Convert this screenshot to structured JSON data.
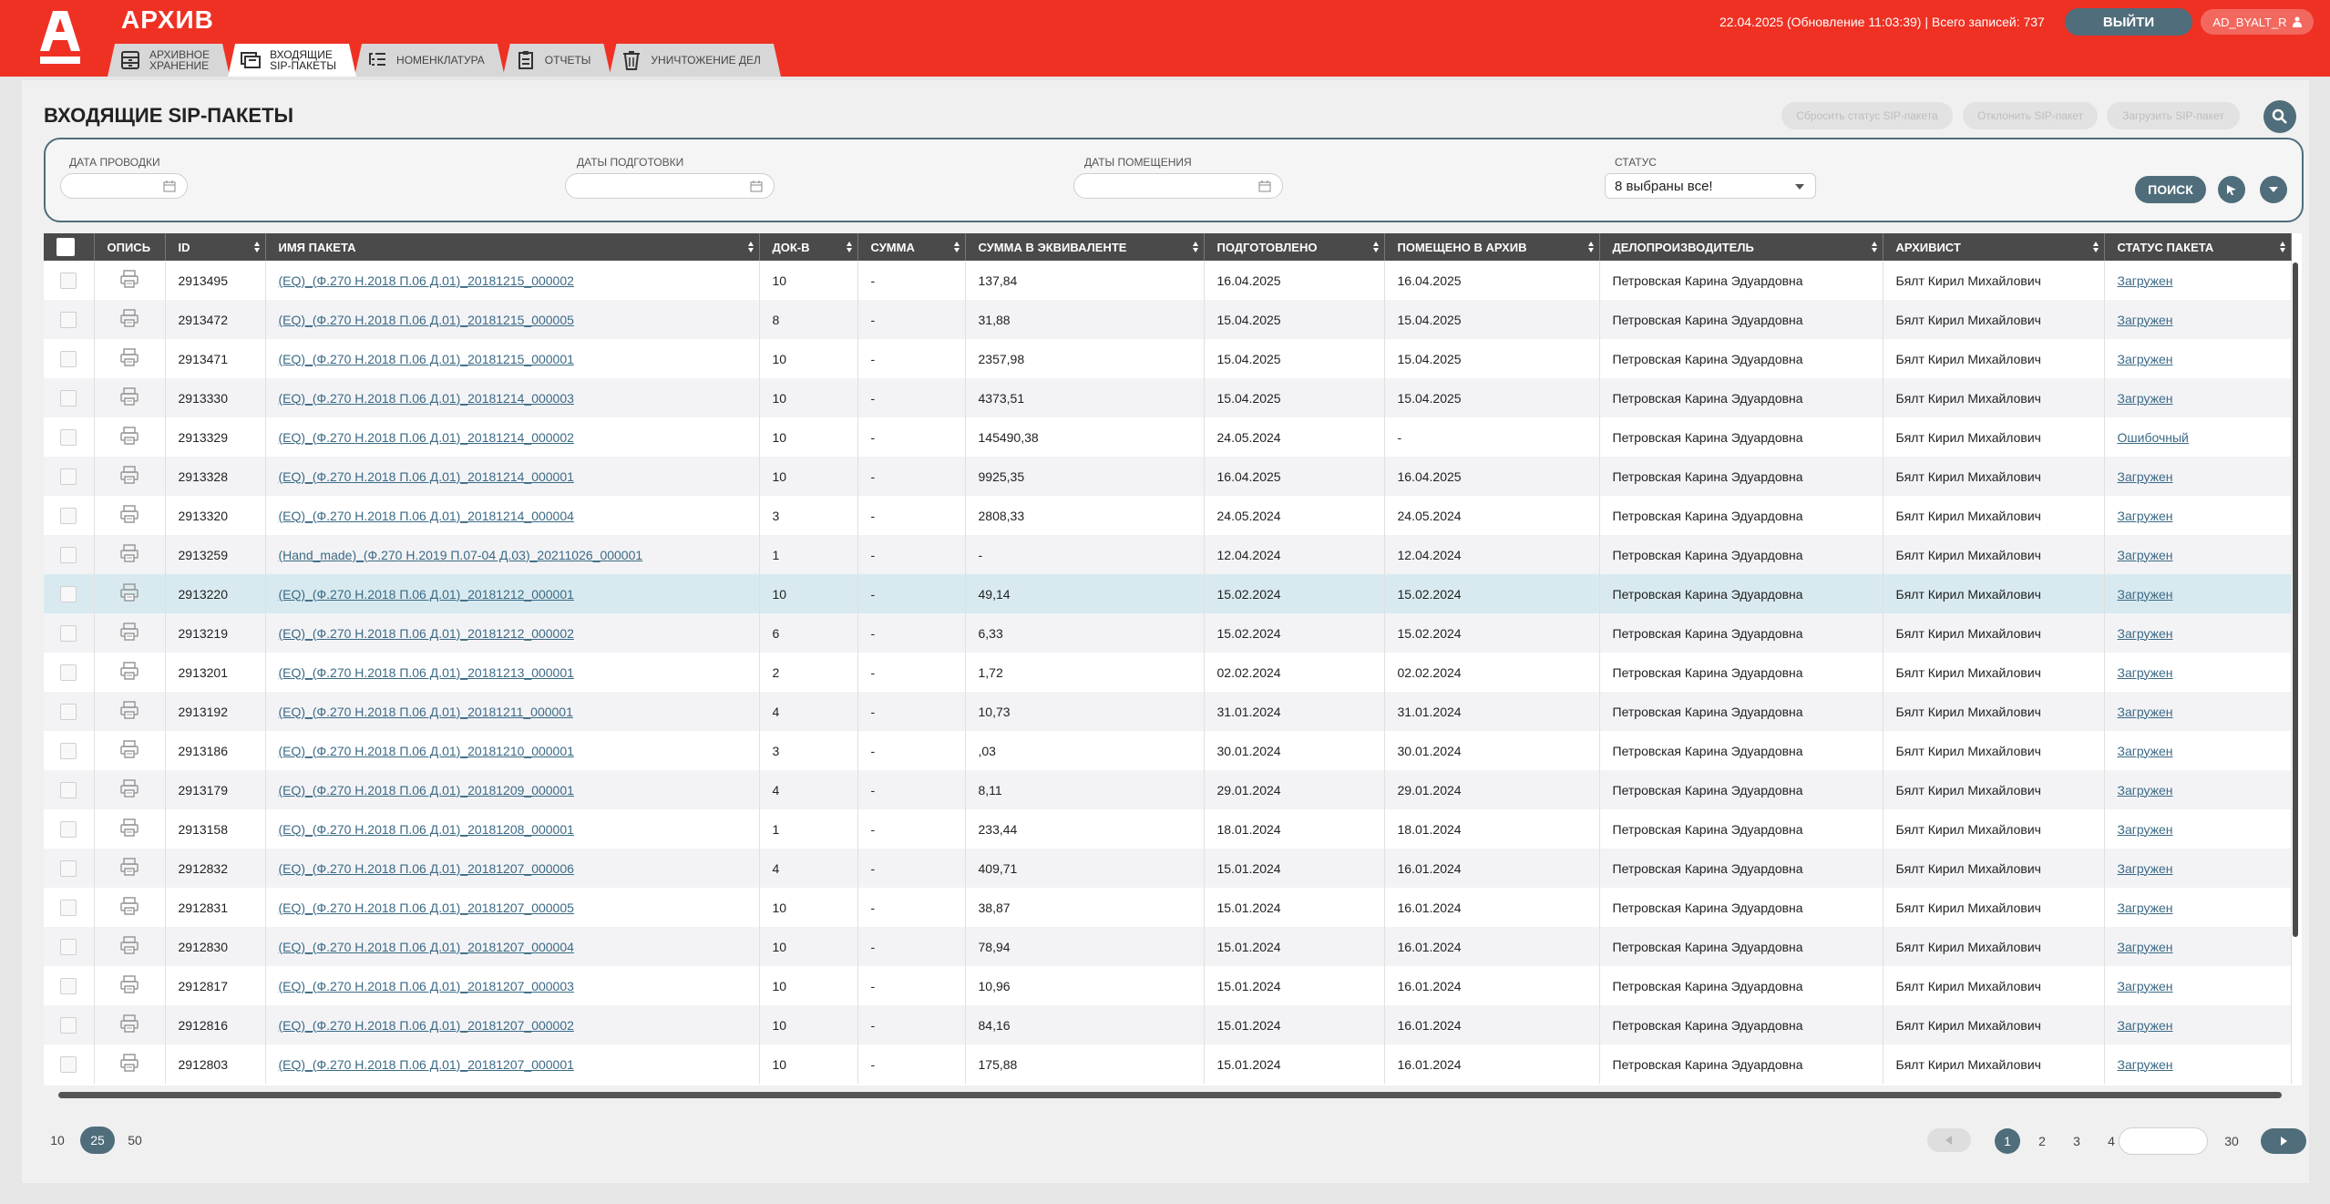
{
  "header": {
    "title": "АРХИВ",
    "info": "22.04.2025 (Обновление 11:03:39) | Всего записей: 737",
    "logout_label": "ВЫЙТИ",
    "user_label": "AD_BYALT_R",
    "tabs": [
      {
        "label": "АРХИВНОЕ\nХРАНЕНИЕ",
        "icon": "archive-storage-icon"
      },
      {
        "label": "ВХОДЯЩИЕ\nSIP-ПАКЕТЫ",
        "icon": "incoming-packages-icon"
      },
      {
        "label": "НОМЕНКЛАТУРА",
        "icon": "nomenclature-icon"
      },
      {
        "label": "ОТЧЕТЫ",
        "icon": "reports-icon"
      },
      {
        "label": "УНИЧТОЖЕНИЕ ДЕЛ",
        "icon": "trash-icon"
      }
    ]
  },
  "page": {
    "title": "ВХОДЯЩИЕ SIP-ПАКЕТЫ",
    "actions": {
      "reset_status": "Сбросить статус SIP-пакета",
      "reject": "Отклонить SIP-пакет",
      "upload": "Загрузить SIP-пакет"
    }
  },
  "filters": {
    "date_posting_label": "ДАТА ПРОВОДКИ",
    "date_preparation_label": "ДАТЫ ПОДГОТОВКИ",
    "date_placement_label": "ДАТЫ ПОМЕЩЕНИЯ",
    "status_label": "СТАТУС",
    "status_value": "8 выбраны все!",
    "search_label": "ПОИСК"
  },
  "table": {
    "columns": [
      "ОПИСЬ",
      "ID",
      "ИМЯ ПАКЕТА",
      "ДОК-В",
      "СУММА",
      "СУММА В ЭКВИВАЛЕНТЕ",
      "ПОДГОТОВЛЕНО",
      "ПОМЕЩЕНО В АРХИВ",
      "ДЕЛОПРОИЗВОДИТЕЛЬ",
      "АРХИВИСТ",
      "СТАТУС ПАКЕТА"
    ],
    "rows": [
      {
        "id": "2913495",
        "name": "(EQ)_(Ф.270 Н.2018 П.06 Д.01)_20181215_000002",
        "docs": "10",
        "sum": "-",
        "equiv": "137,84",
        "prepared": "16.04.2025",
        "archived": "16.04.2025",
        "clerk": "Петровская Карина Эдуардовна",
        "archivist": "Бялт Кирил Михайлович",
        "status": "Загружен"
      },
      {
        "id": "2913472",
        "name": "(EQ)_(Ф.270 Н.2018 П.06 Д.01)_20181215_000005",
        "docs": "8",
        "sum": "-",
        "equiv": "31,88",
        "prepared": "15.04.2025",
        "archived": "15.04.2025",
        "clerk": "Петровская Карина Эдуардовна",
        "archivist": "Бялт Кирил Михайлович",
        "status": "Загружен"
      },
      {
        "id": "2913471",
        "name": "(EQ)_(Ф.270 Н.2018 П.06 Д.01)_20181215_000001",
        "docs": "10",
        "sum": "-",
        "equiv": "2357,98",
        "prepared": "15.04.2025",
        "archived": "15.04.2025",
        "clerk": "Петровская Карина Эдуардовна",
        "archivist": "Бялт Кирил Михайлович",
        "status": "Загружен"
      },
      {
        "id": "2913330",
        "name": "(EQ)_(Ф.270 Н.2018 П.06 Д.01)_20181214_000003",
        "docs": "10",
        "sum": "-",
        "equiv": "4373,51",
        "prepared": "15.04.2025",
        "archived": "15.04.2025",
        "clerk": "Петровская Карина Эдуардовна",
        "archivist": "Бялт Кирил Михайлович",
        "status": "Загружен"
      },
      {
        "id": "2913329",
        "name": "(EQ)_(Ф.270 Н.2018 П.06 Д.01)_20181214_000002",
        "docs": "10",
        "sum": "-",
        "equiv": "145490,38",
        "prepared": "24.05.2024",
        "archived": "-",
        "clerk": "Петровская Карина Эдуардовна",
        "archivist": "Бялт Кирил Михайлович",
        "status": "Ошибочный"
      },
      {
        "id": "2913328",
        "name": "(EQ)_(Ф.270 Н.2018 П.06 Д.01)_20181214_000001",
        "docs": "10",
        "sum": "-",
        "equiv": "9925,35",
        "prepared": "16.04.2025",
        "archived": "16.04.2025",
        "clerk": "Петровская Карина Эдуардовна",
        "archivist": "Бялт Кирил Михайлович",
        "status": "Загружен"
      },
      {
        "id": "2913320",
        "name": "(EQ)_(Ф.270 Н.2018 П.06 Д.01)_20181214_000004",
        "docs": "3",
        "sum": "-",
        "equiv": "2808,33",
        "prepared": "24.05.2024",
        "archived": "24.05.2024",
        "clerk": "Петровская Карина Эдуардовна",
        "archivist": "Бялт Кирил Михайлович",
        "status": "Загружен"
      },
      {
        "id": "2913259",
        "name": "(Hand_made)_(Ф.270 Н.2019 П.07-04 Д.03)_20211026_000001",
        "docs": "1",
        "sum": "-",
        "equiv": "-",
        "prepared": "12.04.2024",
        "archived": "12.04.2024",
        "clerk": "Петровская Карина Эдуардовна",
        "archivist": "Бялт Кирил Михайлович",
        "status": "Загружен"
      },
      {
        "id": "2913220",
        "name": "(EQ)_(Ф.270 Н.2018 П.06 Д.01)_20181212_000001",
        "docs": "10",
        "sum": "-",
        "equiv": "49,14",
        "prepared": "15.02.2024",
        "archived": "15.02.2024",
        "clerk": "Петровская Карина Эдуардовна",
        "archivist": "Бялт Кирил Михайлович",
        "status": "Загружен"
      },
      {
        "id": "2913219",
        "name": "(EQ)_(Ф.270 Н.2018 П.06 Д.01)_20181212_000002",
        "docs": "6",
        "sum": "-",
        "equiv": "6,33",
        "prepared": "15.02.2024",
        "archived": "15.02.2024",
        "clerk": "Петровская Карина Эдуардовна",
        "archivist": "Бялт Кирил Михайлович",
        "status": "Загружен"
      },
      {
        "id": "2913201",
        "name": "(EQ)_(Ф.270 Н.2018 П.06 Д.01)_20181213_000001",
        "docs": "2",
        "sum": "-",
        "equiv": "1,72",
        "prepared": "02.02.2024",
        "archived": "02.02.2024",
        "clerk": "Петровская Карина Эдуардовна",
        "archivist": "Бялт Кирил Михайлович",
        "status": "Загружен"
      },
      {
        "id": "2913192",
        "name": "(EQ)_(Ф.270 Н.2018 П.06 Д.01)_20181211_000001",
        "docs": "4",
        "sum": "-",
        "equiv": "10,73",
        "prepared": "31.01.2024",
        "archived": "31.01.2024",
        "clerk": "Петровская Карина Эдуардовна",
        "archivist": "Бялт Кирил Михайлович",
        "status": "Загружен"
      },
      {
        "id": "2913186",
        "name": "(EQ)_(Ф.270 Н.2018 П.06 Д.01)_20181210_000001",
        "docs": "3",
        "sum": "-",
        "equiv": ",03",
        "prepared": "30.01.2024",
        "archived": "30.01.2024",
        "clerk": "Петровская Карина Эдуардовна",
        "archivist": "Бялт Кирил Михайлович",
        "status": "Загружен"
      },
      {
        "id": "2913179",
        "name": "(EQ)_(Ф.270 Н.2018 П.06 Д.01)_20181209_000001",
        "docs": "4",
        "sum": "-",
        "equiv": "8,11",
        "prepared": "29.01.2024",
        "archived": "29.01.2024",
        "clerk": "Петровская Карина Эдуардовна",
        "archivist": "Бялт Кирил Михайлович",
        "status": "Загружен"
      },
      {
        "id": "2913158",
        "name": "(EQ)_(Ф.270 Н.2018 П.06 Д.01)_20181208_000001",
        "docs": "1",
        "sum": "-",
        "equiv": "233,44",
        "prepared": "18.01.2024",
        "archived": "18.01.2024",
        "clerk": "Петровская Карина Эдуардовна",
        "archivist": "Бялт Кирил Михайлович",
        "status": "Загружен"
      },
      {
        "id": "2912832",
        "name": "(EQ)_(Ф.270 Н.2018 П.06 Д.01)_20181207_000006",
        "docs": "4",
        "sum": "-",
        "equiv": "409,71",
        "prepared": "15.01.2024",
        "archived": "16.01.2024",
        "clerk": "Петровская Карина Эдуардовна",
        "archivist": "Бялт Кирил Михайлович",
        "status": "Загружен"
      },
      {
        "id": "2912831",
        "name": "(EQ)_(Ф.270 Н.2018 П.06 Д.01)_20181207_000005",
        "docs": "10",
        "sum": "-",
        "equiv": "38,87",
        "prepared": "15.01.2024",
        "archived": "16.01.2024",
        "clerk": "Петровская Карина Эдуардовна",
        "archivist": "Бялт Кирил Михайлович",
        "status": "Загружен"
      },
      {
        "id": "2912830",
        "name": "(EQ)_(Ф.270 Н.2018 П.06 Д.01)_20181207_000004",
        "docs": "10",
        "sum": "-",
        "equiv": "78,94",
        "prepared": "15.01.2024",
        "archived": "16.01.2024",
        "clerk": "Петровская Карина Эдуардовна",
        "archivist": "Бялт Кирил Михайлович",
        "status": "Загружен"
      },
      {
        "id": "2912817",
        "name": "(EQ)_(Ф.270 Н.2018 П.06 Д.01)_20181207_000003",
        "docs": "10",
        "sum": "-",
        "equiv": "10,96",
        "prepared": "15.01.2024",
        "archived": "16.01.2024",
        "clerk": "Петровская Карина Эдуардовна",
        "archivist": "Бялт Кирил Михайлович",
        "status": "Загружен"
      },
      {
        "id": "2912816",
        "name": "(EQ)_(Ф.270 Н.2018 П.06 Д.01)_20181207_000002",
        "docs": "10",
        "sum": "-",
        "equiv": "84,16",
        "prepared": "15.01.2024",
        "archived": "16.01.2024",
        "clerk": "Петровская Карина Эдуардовна",
        "archivist": "Бялт Кирил Михайлович",
        "status": "Загружен"
      },
      {
        "id": "2912803",
        "name": "(EQ)_(Ф.270 Н.2018 П.06 Д.01)_20181207_000001",
        "docs": "10",
        "sum": "-",
        "equiv": "175,88",
        "prepared": "15.01.2024",
        "archived": "16.01.2024",
        "clerk": "Петровская Карина Эдуардовна",
        "archivist": "Бялт Кирил Михайлович",
        "status": "Загружен"
      }
    ],
    "highlighted_row": 8
  },
  "pagination": {
    "page_sizes": [
      "10",
      "25",
      "50"
    ],
    "active_page_size": "25",
    "pages": [
      "1",
      "2",
      "3",
      "4"
    ],
    "active_page": "1",
    "last_page": "30"
  },
  "colors": {
    "brand_red": "#ef3124",
    "accent": "#4f6d7a",
    "header_bg": "#4a4a4a",
    "highlight_row": "#d8eaf0"
  }
}
